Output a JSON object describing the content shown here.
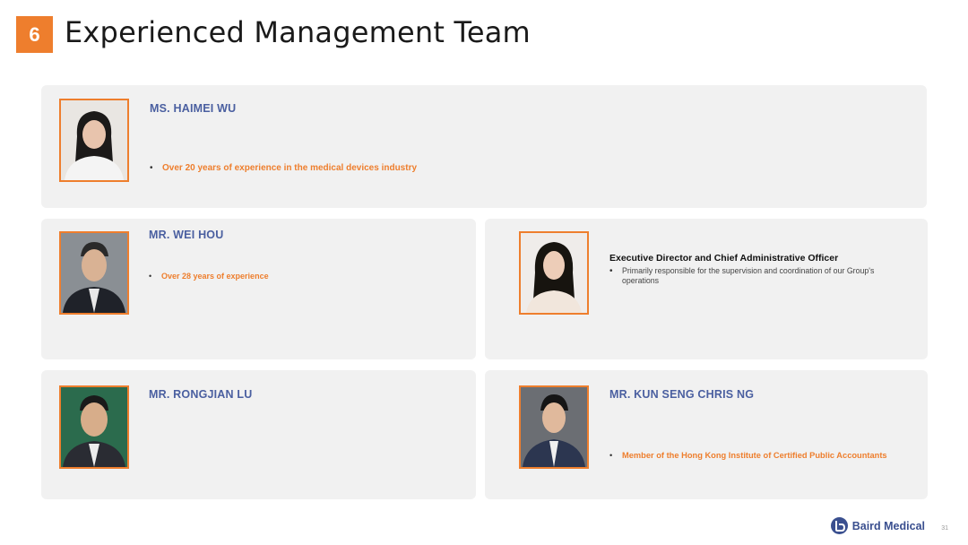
{
  "header": {
    "section_number": "6",
    "title": "Experienced Management Team"
  },
  "members": [
    {
      "name": "MS. HAIMEI WU",
      "bullets": [
        "Over 20 years of experience in the medical devices industry"
      ]
    },
    {
      "name": "MR. WEI HOU",
      "bullets": [
        "Over 28 years of experience"
      ]
    },
    {
      "role": "Executive Director and Chief Administrative Officer",
      "bullets": [
        "Primarily responsible for the supervision and coordination of our Group's operations"
      ]
    },
    {
      "name": "MR. RONGJIAN LU"
    },
    {
      "name": "MR. KUN SENG CHRIS NG",
      "bullets": [
        "Member of the Hong Kong Institute of Certified Public Accountants"
      ]
    }
  ],
  "footer": {
    "brand": "Baird Medical",
    "page": "31"
  }
}
